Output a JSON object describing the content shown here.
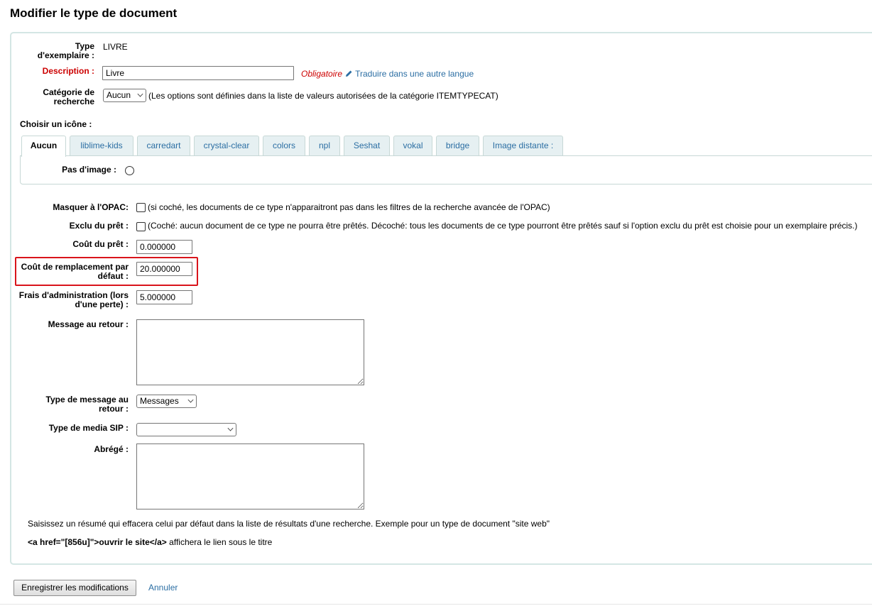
{
  "page": {
    "title": "Modifier le type de document"
  },
  "form": {
    "itemtype": {
      "label": "Type d'exemplaire :",
      "value": "LIVRE"
    },
    "description": {
      "label": "Description :",
      "value": "Livre",
      "required_text": "Obligatoire",
      "translate_link": "Traduire dans une autre langue"
    },
    "search_category": {
      "label": "Catégorie de recherche",
      "selected": "Aucun",
      "hint": "(Les options sont définies dans la liste de valeurs autorisées de la catégorie ITEMTYPECAT)"
    },
    "icon_label": "Choisir un icône :",
    "icon_tabs": [
      {
        "label": "Aucun",
        "active": true
      },
      {
        "label": "liblime-kids"
      },
      {
        "label": "carredart"
      },
      {
        "label": "crystal-clear"
      },
      {
        "label": "colors"
      },
      {
        "label": "npl"
      },
      {
        "label": "Seshat"
      },
      {
        "label": "vokal"
      },
      {
        "label": "bridge"
      },
      {
        "label": "Image distante :"
      }
    ],
    "no_image_label": "Pas d'image :",
    "hide_opac": {
      "label": "Masquer à l'OPAC:",
      "hint": "(si coché, les documents de ce type n'apparaitront pas dans les filtres de la recherche avancée de l'OPAC)"
    },
    "not_for_loan": {
      "label": "Exclu du prêt :",
      "hint": "(Coché: aucun document de ce type ne pourra être prêtés. Décoché: tous les documents de ce type pourront être prêtés sauf si l'option exclu du prêt est choisie pour un exemplaire précis.)"
    },
    "rental_charge": {
      "label": "Coût du prêt :",
      "value": "0.000000"
    },
    "replacement_price": {
      "label": "Coût de remplacement par défaut :",
      "value": "20.000000"
    },
    "processing_fee": {
      "label": "Frais d'administration (lors d'une perte) :",
      "value": "5.000000"
    },
    "checkin_message": {
      "label": "Message au retour :",
      "value": ""
    },
    "checkin_message_type": {
      "label": "Type de message au retour :",
      "selected": "Messages"
    },
    "sip_media_type": {
      "label": "Type de media SIP :",
      "selected": ""
    },
    "summary": {
      "label": "Abrégé :",
      "value": "",
      "help": "Saisissez un résumé qui effacera celui par défaut dans la liste de résultats d'une recherche. Exemple pour un type de document \"site web\"",
      "example_code": "<a href=\"[856u]\">ouvrir le site</a>",
      "example_suffix": "affichera le lien sous le titre"
    }
  },
  "actions": {
    "save": "Enregistrer les modifications",
    "cancel": "Annuler"
  },
  "colors": {
    "required": "#cc0000",
    "link": "#2b6ea3",
    "highlight_border": "#d9141b",
    "fieldset_border": "#d4e6e4"
  }
}
